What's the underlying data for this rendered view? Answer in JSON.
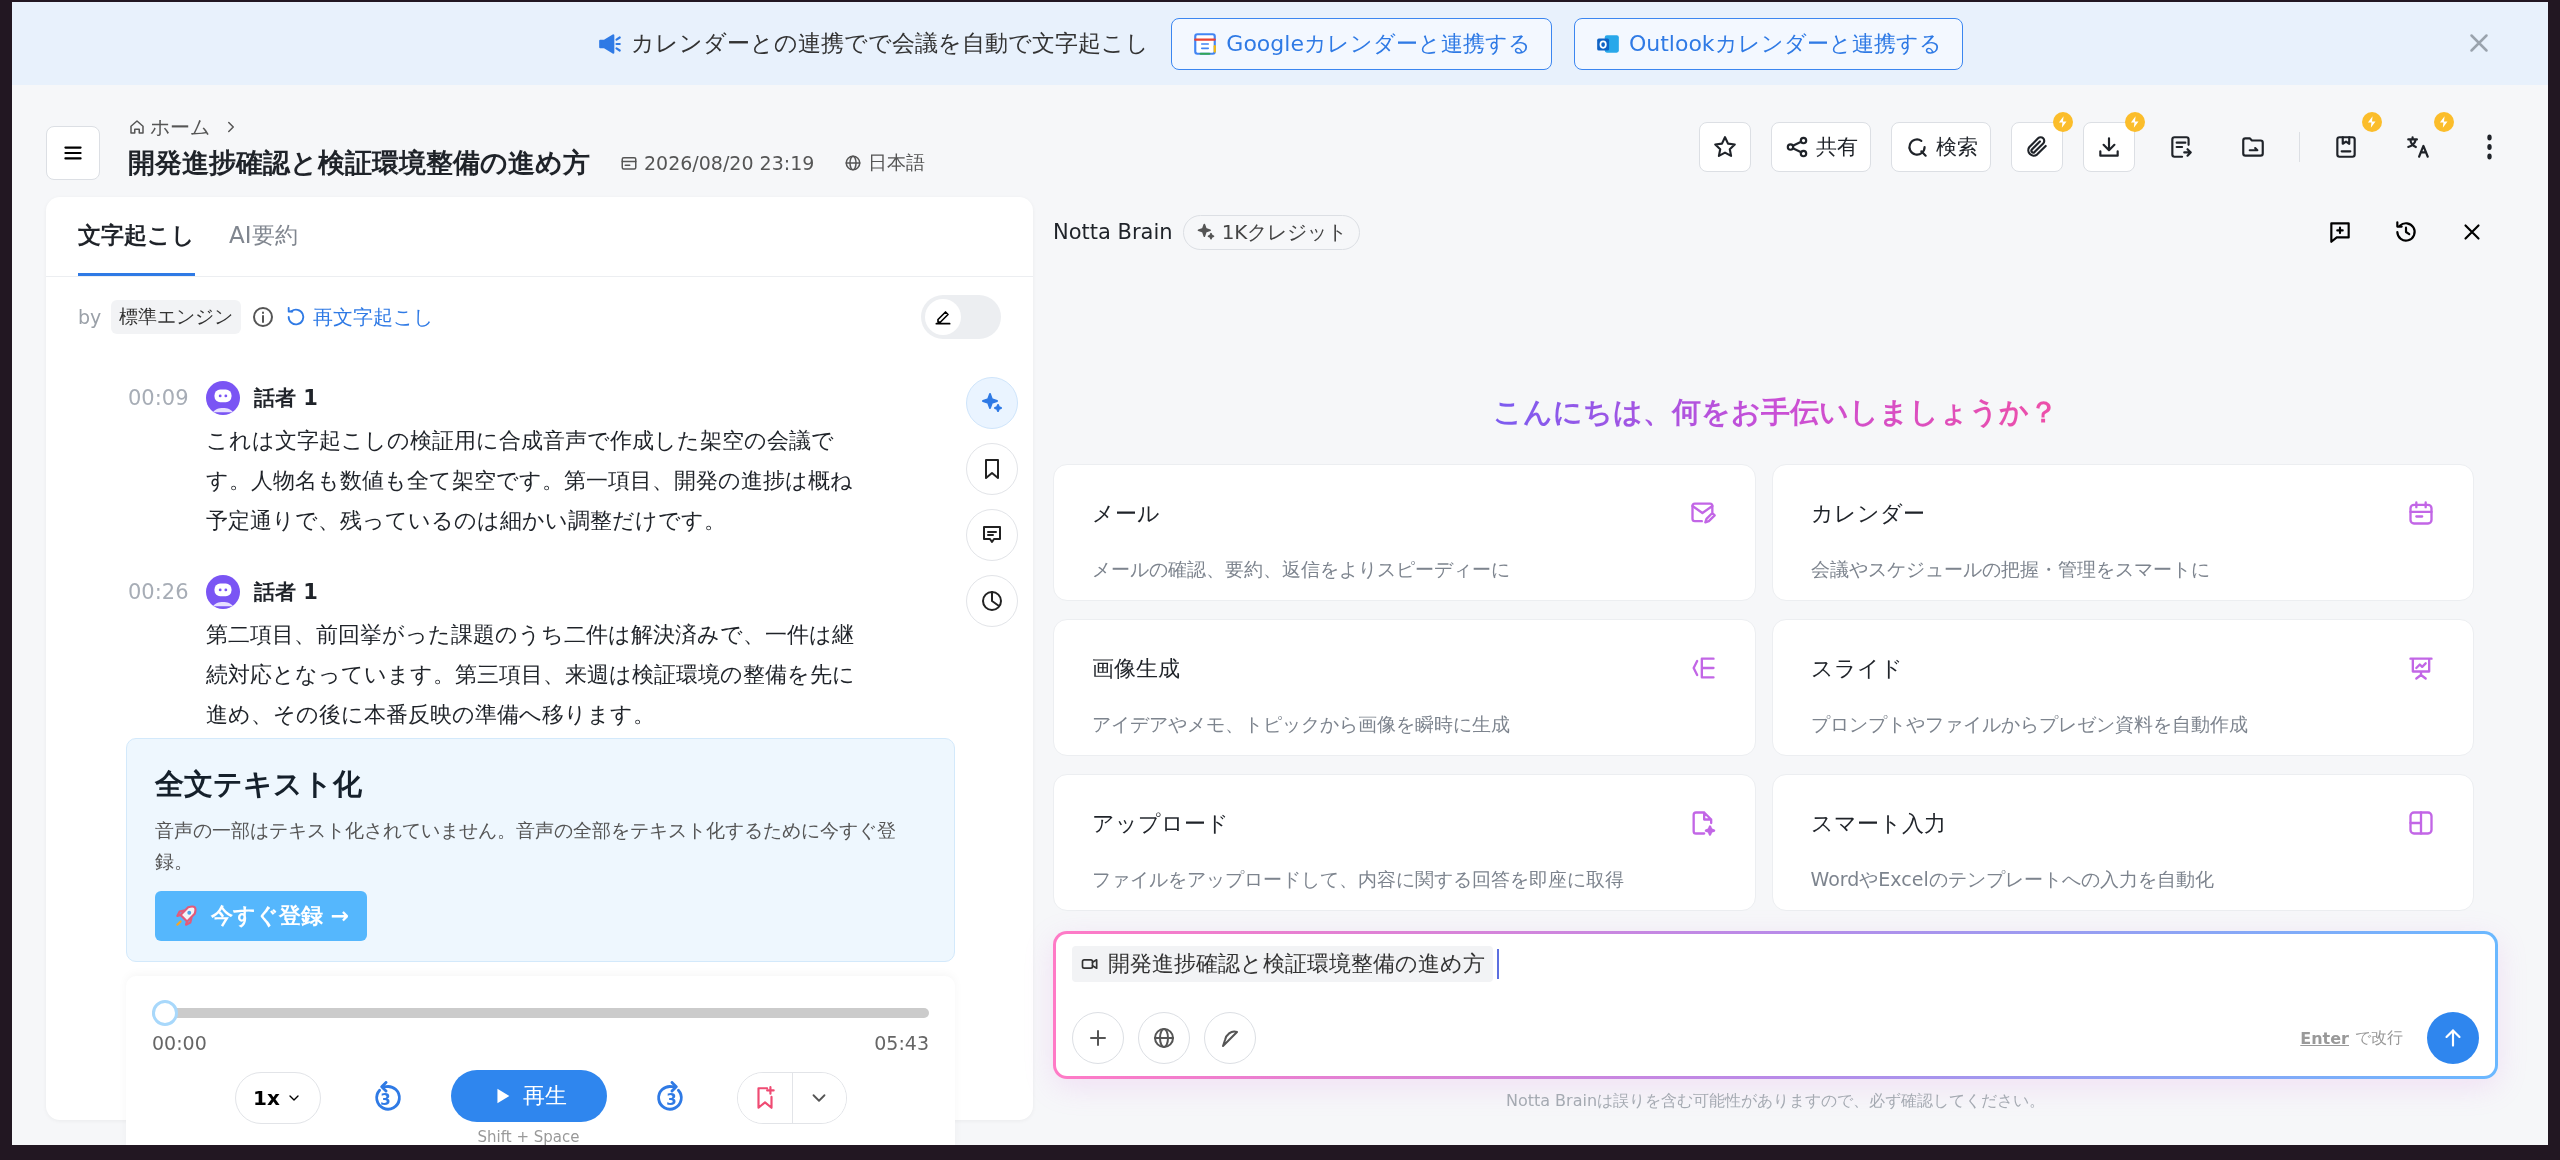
{
  "banner": {
    "text": "カレンダーとの連携でで会議を自動で文字起こし",
    "buttons": [
      {
        "kind": "google",
        "label": "Googleカレンダーと連携する"
      },
      {
        "kind": "outlook",
        "label": "Outlookカレンダーと連携する"
      }
    ]
  },
  "breadcrumb": {
    "home": "ホーム"
  },
  "title": "開発進捗確認と検証環境整備の進め方",
  "date": "2026/08/20 23:19",
  "language": "日本語",
  "toolbar": [
    {
      "kind": "star",
      "premium": false
    },
    {
      "kind": "share",
      "label": "共有",
      "premium": false
    },
    {
      "kind": "search",
      "label": "検索",
      "premium": false
    },
    {
      "kind": "attach",
      "premium": true
    },
    {
      "kind": "download",
      "premium": true
    },
    {
      "kind": "export",
      "premium": false
    },
    {
      "kind": "folder",
      "premium": false
    },
    {
      "kind": "save",
      "premium": true
    },
    {
      "kind": "translate",
      "premium": true
    },
    {
      "kind": "more",
      "premium": false
    }
  ],
  "tabs": [
    {
      "label": "文字起こし",
      "selected": true
    },
    {
      "label": "AI要約",
      "selected": false
    }
  ],
  "engine": {
    "by": "by",
    "name": "標準エンジン",
    "retranscribe": "再文字起こし",
    "edit_mode": false
  },
  "segments": [
    {
      "time": "00:09",
      "speaker": "話者 1",
      "text": "これは文字起こしの検証用に合成音声で作成した架空の会議です。人物名も数値も全て架空です。第一項目、開発の進捗は概ね予定通りで、残っているのは細かい調整だけです。"
    },
    {
      "time": "00:26",
      "speaker": "話者 1",
      "text": "第二項目、前回挙がった課題のうち二件は解決済みで、一件は継続対応となっています。第三項目、来週は検証環境の整備を先に進め、その後に本番反映の準備へ移ります。"
    }
  ],
  "side_tools": [
    {
      "kind": "sparkle",
      "selected": true
    },
    {
      "kind": "bookmark",
      "selected": false
    },
    {
      "kind": "comment",
      "selected": false
    },
    {
      "kind": "chart",
      "selected": false
    }
  ],
  "promo": {
    "title": "全文テキスト化",
    "text": "音声の一部はテキスト化されていません。音声の全部をテキスト化するために今すぐ登録。",
    "button": "今すぐ登録 →"
  },
  "player": {
    "level": 0,
    "start": "00:00",
    "end": "05:43",
    "speed": "1x",
    "rewind": "3",
    "play": "再生",
    "forward": "3",
    "shortcut": "Shift + Space"
  },
  "brain": {
    "name": "Notta Brain",
    "credit": "1Kクレジット",
    "greeting": "こんにちは、何をお手伝いしましょうか？",
    "cards": [
      {
        "kind": "mail",
        "title": "メール",
        "description": "メールの確認、要約、返信をよりスピーディーに"
      },
      {
        "kind": "calendar",
        "title": "カレンダー",
        "description": "会議やスケジュールの把握・管理をスマートに"
      },
      {
        "kind": "image",
        "title": "画像生成",
        "description": "アイデアやメモ、トピックから画像を瞬時に生成"
      },
      {
        "kind": "slide",
        "title": "スライド",
        "description": "プロンプトやファイルからプレゼン資料を自動作成"
      },
      {
        "kind": "upload",
        "title": "アップロード",
        "description": "ファイルをアップロードして、内容に関する回答を即座に取得"
      },
      {
        "kind": "form",
        "title": "スマート入力",
        "description": "WordやExcelのテンプレートへの入力を自動化"
      }
    ],
    "context": "開発進捗確認と検証環境整備の進め方",
    "enter_key": "Enter",
    "enter_hint": "で改行",
    "disclaimer": "Notta Brainは誤りを含む可能性がありますので、必ず確認してください。"
  }
}
